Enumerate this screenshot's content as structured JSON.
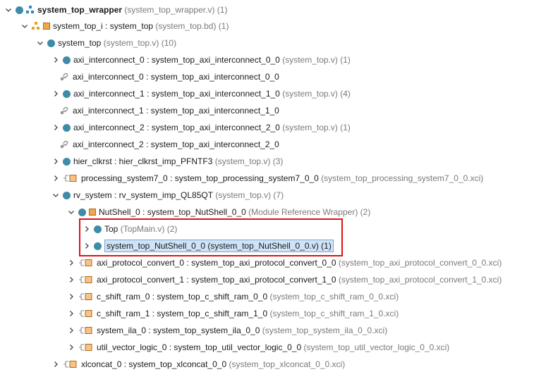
{
  "tree": {
    "root": {
      "name": "system_top_wrapper",
      "detail": "(system_top_wrapper.v) (1)"
    },
    "system_top_i": {
      "name": "system_top_i : system_top",
      "detail": "(system_top.bd) (1)"
    },
    "system_top": {
      "name": "system_top",
      "detail": "(system_top.v) (10)"
    },
    "axi_ic_0": {
      "name": "axi_interconnect_0 : system_top_axi_interconnect_0_0",
      "detail": "(system_top.v) (1)"
    },
    "axi_ic_0_ref": {
      "name": "axi_interconnect_0 : system_top_axi_interconnect_0_0"
    },
    "axi_ic_1": {
      "name": "axi_interconnect_1 : system_top_axi_interconnect_1_0",
      "detail": "(system_top.v) (4)"
    },
    "axi_ic_1_ref": {
      "name": "axi_interconnect_1 : system_top_axi_interconnect_1_0"
    },
    "axi_ic_2": {
      "name": "axi_interconnect_2 : system_top_axi_interconnect_2_0",
      "detail": "(system_top.v) (1)"
    },
    "axi_ic_2_ref": {
      "name": "axi_interconnect_2 : system_top_axi_interconnect_2_0"
    },
    "hier_clkrst": {
      "name": "hier_clkrst : hier_clkrst_imp_PFNTF3",
      "detail": "(system_top.v) (3)"
    },
    "ps7": {
      "name": "processing_system7_0 : system_top_processing_system7_0_0",
      "detail": "(system_top_processing_system7_0_0.xci)"
    },
    "rv_system": {
      "name": "rv_system : rv_system_imp_QL85QT",
      "detail": "(system_top.v) (7)"
    },
    "nutshell": {
      "name": "NutShell_0 : system_top_NutShell_0_0",
      "detail": "(Module Reference Wrapper) (2)"
    },
    "top": {
      "name": "Top",
      "detail": "(TopMain.v) (2)"
    },
    "nutshell_v": {
      "name": "system_top_NutShell_0_0 (system_top_NutShell_0_0.v) (1)"
    },
    "apc0": {
      "name": "axi_protocol_convert_0 : system_top_axi_protocol_convert_0_0",
      "detail": "(system_top_axi_protocol_convert_0_0.xci)"
    },
    "apc1": {
      "name": "axi_protocol_convert_1 : system_top_axi_protocol_convert_1_0",
      "detail": "(system_top_axi_protocol_convert_1_0.xci)"
    },
    "csr0": {
      "name": "c_shift_ram_0 : system_top_c_shift_ram_0_0",
      "detail": "(system_top_c_shift_ram_0_0.xci)"
    },
    "csr1": {
      "name": "c_shift_ram_1 : system_top_c_shift_ram_1_0",
      "detail": "(system_top_c_shift_ram_1_0.xci)"
    },
    "ila": {
      "name": "system_ila_0 : system_top_system_ila_0_0",
      "detail": "(system_top_system_ila_0_0.xci)"
    },
    "uvl": {
      "name": "util_vector_logic_0 : system_top_util_vector_logic_0_0",
      "detail": "(system_top_util_vector_logic_0_0.xci)"
    },
    "xlconcat": {
      "name": "xlconcat_0 : system_top_xlconcat_0_0",
      "detail": "(system_top_xlconcat_0_0.xci)"
    }
  },
  "colors": {
    "module_dot": "#3f8ba8",
    "hierarchy_icon": "#2d8ac7",
    "ip_icon": "#f0a64a",
    "selection": "#cfe3f7",
    "highlight_box": "#e0101a"
  },
  "icons": [
    "chevron-down-icon",
    "chevron-right-icon",
    "module-icon",
    "hierarchy-icon",
    "block-design-icon",
    "ip-core-icon",
    "reference-link-icon"
  ]
}
